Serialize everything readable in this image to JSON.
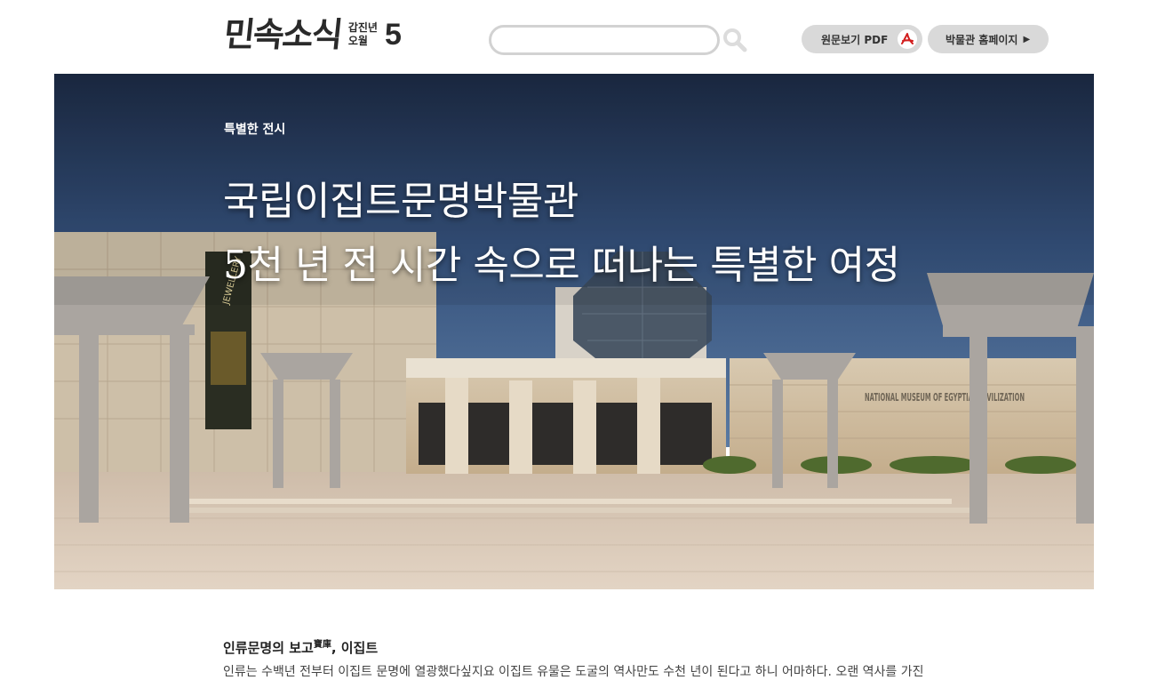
{
  "header": {
    "logo_title": "민속소식",
    "logo_year": "갑진년",
    "logo_month": "오월",
    "logo_issue": "5",
    "search_placeholder": "",
    "pdf_button_label": "원문보기 PDF",
    "home_button_label": "박물관 홈페이지",
    "home_button_arrow": "▶"
  },
  "hero": {
    "category": "특별한 전시",
    "title_line1": "국립이집트문명박물관",
    "title_line2": "5천 년 전 시간 속으로 떠나는 특별한 여정",
    "image_signage_en": "NATIONAL MUSEUM OF EGYPTIAN CIVILIZATION",
    "image_banner_text": "JEWELLERY"
  },
  "article": {
    "heading_main": "인류문명의 보고",
    "heading_hanja": "寶庫",
    "heading_tail": ", 이집트",
    "body_first_line": "인류는 수백년 전부터 이집트 문명에 열광했다싶지요 이집트 유물은 도굴의 역사만도 수천 년이 된다고 하니 어마하다. 오랜 역사를 가진"
  },
  "colors": {
    "pill_bg": "#d9d9d9",
    "search_border": "#d2d2d2",
    "sky_top": "#1c2a44",
    "sky_bottom": "#4a6a92",
    "pdf_red": "#d21f1f"
  }
}
